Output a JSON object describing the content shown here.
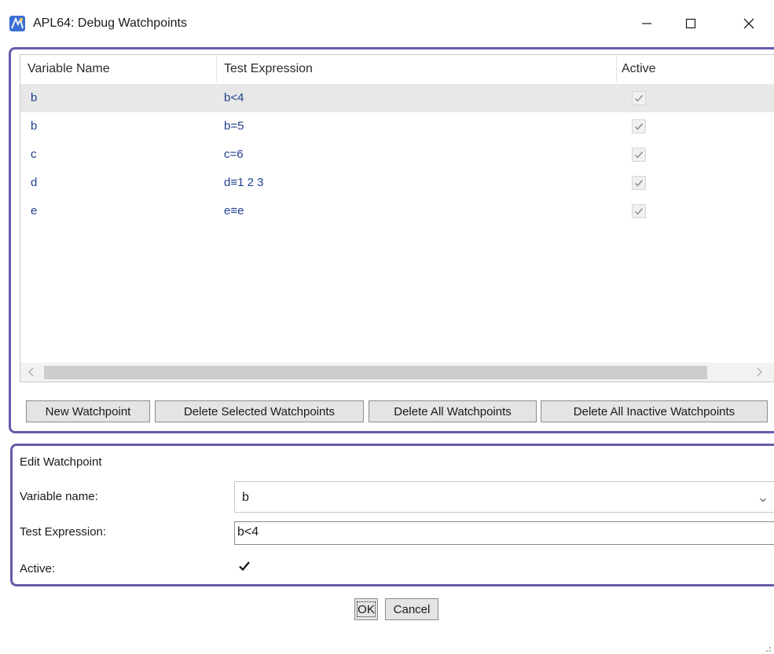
{
  "window": {
    "title": "APL64: Debug Watchpoints",
    "icon": "apl64-app-icon",
    "controls": {
      "minimize_icon": "minimize-icon",
      "maximize_icon": "maximize-icon",
      "close_icon": "close-icon"
    }
  },
  "watchpoints_list": {
    "columns": [
      "Variable Name",
      "Test Expression",
      "Active"
    ],
    "rows": [
      {
        "variable": "b",
        "expression": "b<4",
        "active": true,
        "selected": true
      },
      {
        "variable": "b",
        "expression": "b=5",
        "active": true,
        "selected": false
      },
      {
        "variable": "c",
        "expression": "c=6",
        "active": true,
        "selected": false
      },
      {
        "variable": "d",
        "expression": "d≡1 2 3",
        "active": true,
        "selected": false
      },
      {
        "variable": "e",
        "expression": "e≡e",
        "active": true,
        "selected": false
      }
    ]
  },
  "toolbar": {
    "new_label": "New Watchpoint",
    "delete_selected_label": "Delete Selected Watchpoints",
    "delete_all_label": "Delete All Watchpoints",
    "delete_inactive_label": "Delete All Inactive Watchpoints"
  },
  "edit": {
    "section_title": "Edit Watchpoint",
    "variable_label": "Variable name:",
    "variable_value": "b",
    "expression_label": "Test Expression:",
    "expression_value": "b<4",
    "active_label": "Active:",
    "active_checked": true
  },
  "dialog_buttons": {
    "ok_label": "OK",
    "cancel_label": "Cancel"
  },
  "colors": {
    "accent_border": "#6a5aa8",
    "row_text": "#1f3f8f",
    "selected_row": "#e8e8e8"
  }
}
